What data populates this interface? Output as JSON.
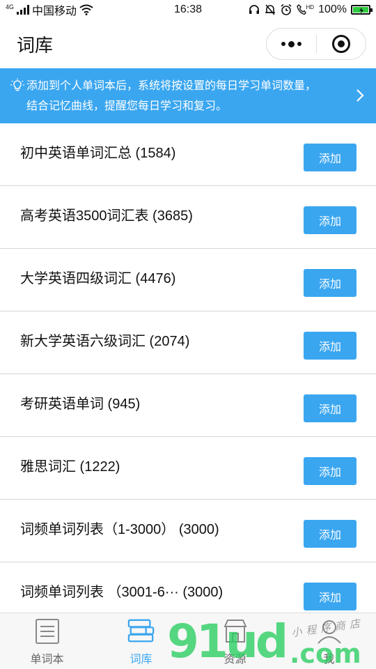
{
  "status_bar": {
    "network": "4G",
    "carrier": "中国移动",
    "time": "16:38",
    "hd_label": "HD",
    "battery": "100%",
    "battery_level": 1.0
  },
  "header": {
    "title": "词库"
  },
  "banner": {
    "line1": "添加到个人单词本后，系统将按设置的每日学习单词数量，",
    "line2": "结合记忆曲线，提醒您每日学习和复习。"
  },
  "wordbooks": [
    {
      "label": "初中英语单词汇总 (1584)",
      "button": "添加"
    },
    {
      "label": "高考英语3500词汇表 (3685)",
      "button": "添加"
    },
    {
      "label": "大学英语四级词汇 (4476)",
      "button": "添加"
    },
    {
      "label": "新大学英语六级词汇 (2074)",
      "button": "添加"
    },
    {
      "label": "考研英语单词 (945)",
      "button": "添加"
    },
    {
      "label": "雅思词汇 (1222)",
      "button": "添加"
    },
    {
      "label": "词频单词列表（1-3000） (3000)",
      "button": "添加"
    },
    {
      "label": "词频单词列表 （3001-6··· (3000)",
      "button": "添加"
    }
  ],
  "tabbar": {
    "tabs": [
      {
        "label": "单词本"
      },
      {
        "label": "词库"
      },
      {
        "label": "资源"
      },
      {
        "label": "我"
      }
    ]
  },
  "watermark": {
    "main": "91ud",
    "suffix": ".com",
    "shop": "小程序商店"
  },
  "colors": {
    "accent": "#3aa6f0",
    "watermark": "#28cd5f"
  }
}
